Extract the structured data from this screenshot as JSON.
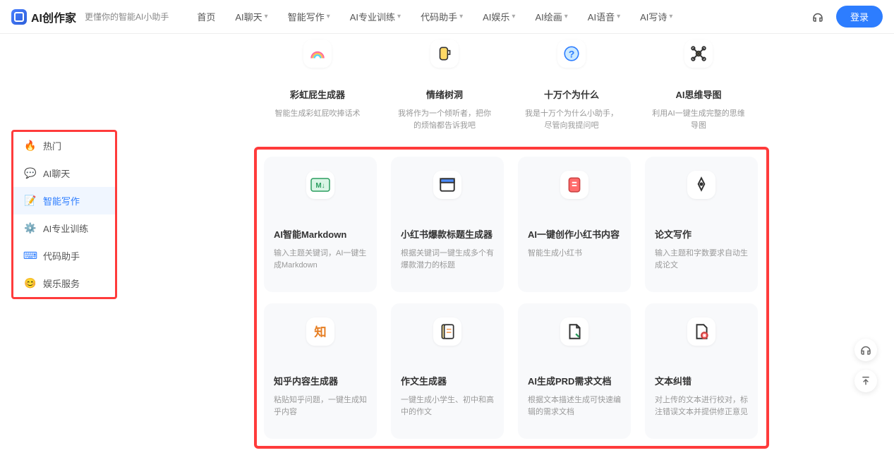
{
  "header": {
    "logo": "AI创作家",
    "tagline": "更懂你的智能AI小助手",
    "nav": [
      "首页",
      "AI聊天",
      "智能写作",
      "AI专业训练",
      "代码助手",
      "AI娱乐",
      "AI绘画",
      "AI语音",
      "AI写诗"
    ],
    "login": "登录"
  },
  "sidebar": {
    "items": [
      {
        "label": "热门",
        "icon": "fire"
      },
      {
        "label": "AI聊天",
        "icon": "chat"
      },
      {
        "label": "智能写作",
        "icon": "write",
        "active": true
      },
      {
        "label": "AI专业训练",
        "icon": "train"
      },
      {
        "label": "代码助手",
        "icon": "code"
      },
      {
        "label": "娱乐服务",
        "icon": "ent"
      }
    ]
  },
  "row1": [
    {
      "title": "彩虹屁生成器",
      "desc": "智能生成彩虹屁吹捧话术"
    },
    {
      "title": "情绪树洞",
      "desc": "我将作为一个倾听者，把你的烦恼都告诉我吧"
    },
    {
      "title": "十万个为什么",
      "desc": "我是十万个为什么小助手，尽管向我提问吧"
    },
    {
      "title": "AI思维导图",
      "desc": "利用AI一键生成完整的思维导图"
    }
  ],
  "row2": [
    {
      "title": "AI智能Markdown",
      "desc": "输入主题关键词，AI一键生成Markdown"
    },
    {
      "title": "小红书爆款标题生成器",
      "desc": "根据关键词一键生成多个有爆款潜力的标题"
    },
    {
      "title": "AI一键创作小红书内容",
      "desc": "智能生成小红书"
    },
    {
      "title": "论文写作",
      "desc": "输入主题和字数要求自动生成论文"
    }
  ],
  "row3": [
    {
      "title": "知乎内容生成器",
      "desc": "粘贴知乎问题，一键生成知乎内容"
    },
    {
      "title": "作文生成器",
      "desc": "一键生成小学生、初中和高中的作文"
    },
    {
      "title": "AI生成PRD需求文档",
      "desc": "根据文本描述生成可快速编辑的需求文档"
    },
    {
      "title": "文本纠错",
      "desc": "对上传的文本进行校对，标注错误文本并提供修正意见"
    }
  ]
}
